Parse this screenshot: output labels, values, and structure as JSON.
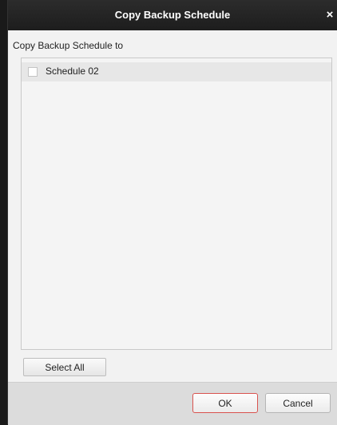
{
  "dialog": {
    "title": "Copy Backup Schedule",
    "close_glyph": "×",
    "section_label": "Copy Backup Schedule to",
    "schedules": [
      {
        "label": "Schedule 02",
        "checked": false
      }
    ],
    "select_all_label": "Select All",
    "ok_label": "OK",
    "cancel_label": "Cancel"
  },
  "colors": {
    "titlebar": "#222222",
    "ok_border": "#d9534f",
    "panel_bg": "#f4f4f4"
  }
}
